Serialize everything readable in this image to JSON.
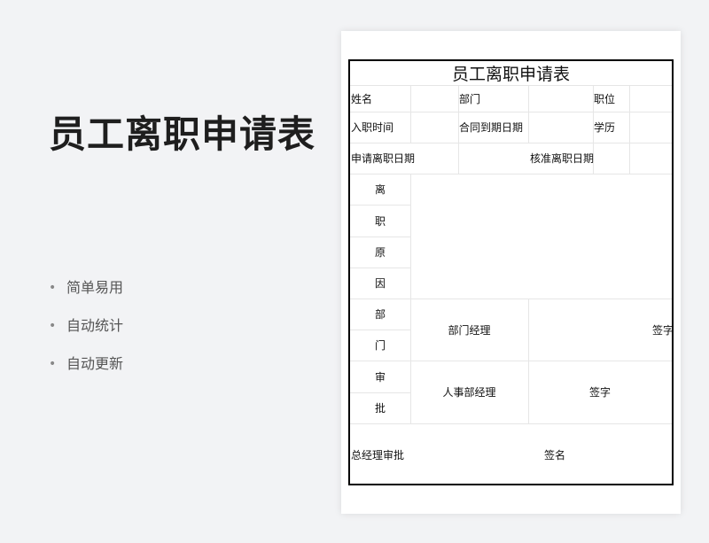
{
  "page": {
    "title": "员工离职申请表",
    "features": [
      "简单易用",
      "自动统计",
      "自动更新"
    ],
    "bullet": "•"
  },
  "form": {
    "title": "员工离职申请表",
    "row1": {
      "name": "姓名",
      "dept": "部门",
      "position": "职位"
    },
    "row2": {
      "hire_date": "入职时间",
      "contract_end": "合同到期日期",
      "education": "学历"
    },
    "row3": {
      "apply_date": "申请离职日期",
      "approved_date": "核准离职日期"
    },
    "reason_chars": [
      "离",
      "职",
      "原",
      "因"
    ],
    "approval_chars": [
      "部",
      "门",
      "审",
      "批"
    ],
    "dept_manager": "部门经理",
    "sign1": "签字",
    "hr_manager": "人事部经理",
    "sign2": "签字",
    "gm_approval": "总经理审批",
    "sign3": "签名"
  }
}
